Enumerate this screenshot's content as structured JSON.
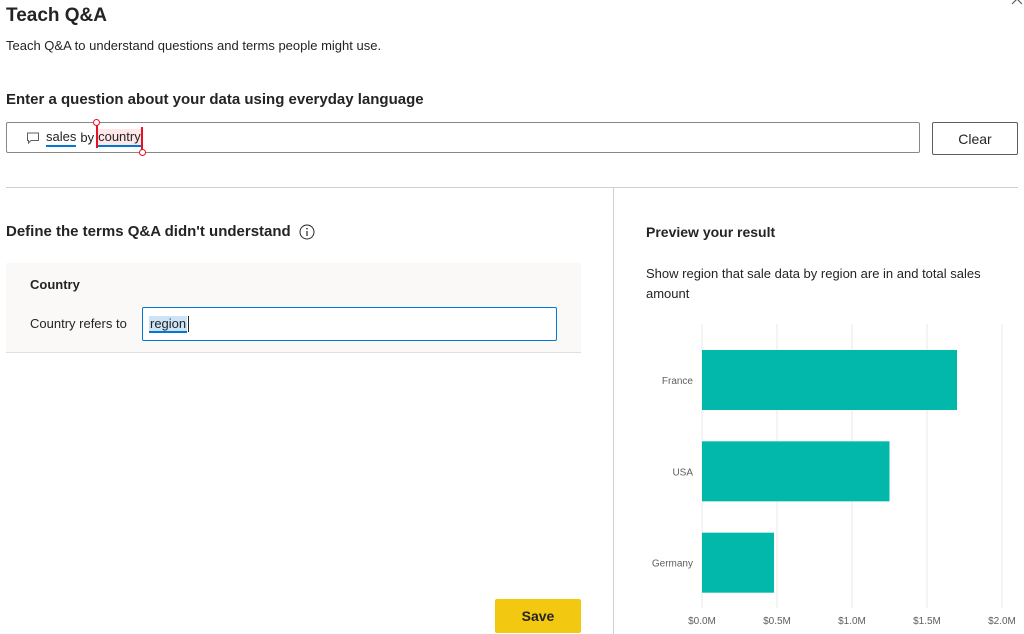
{
  "dialog": {
    "title": "Teach Q&A",
    "subtitle": "Teach Q&A to understand questions and terms people might use.",
    "close_icon": "close-icon"
  },
  "question": {
    "heading": "Enter a question about your data using everyday language",
    "terms": [
      "sales",
      "by",
      "country"
    ],
    "clear_label": "Clear"
  },
  "define": {
    "heading": "Define the terms Q&A didn't understand",
    "term_name": "Country",
    "refers_label": "Country refers to",
    "refers_value": "region"
  },
  "save_label": "Save",
  "preview": {
    "heading": "Preview your result",
    "description": "Show region that sale data by region are in and total sales amount"
  },
  "colors": {
    "bar": "#01b8aa",
    "save": "#f2c811",
    "accent": "#0078d4"
  },
  "chart_data": {
    "type": "bar",
    "orientation": "horizontal",
    "categories": [
      "France",
      "USA",
      "Germany"
    ],
    "values": [
      1.7,
      1.25,
      0.48
    ],
    "x_ticks": [
      "$0.0M",
      "$0.5M",
      "$1.0M",
      "$1.5M",
      "$2.0M"
    ],
    "xlim": [
      0,
      2.0
    ],
    "grid": true
  }
}
